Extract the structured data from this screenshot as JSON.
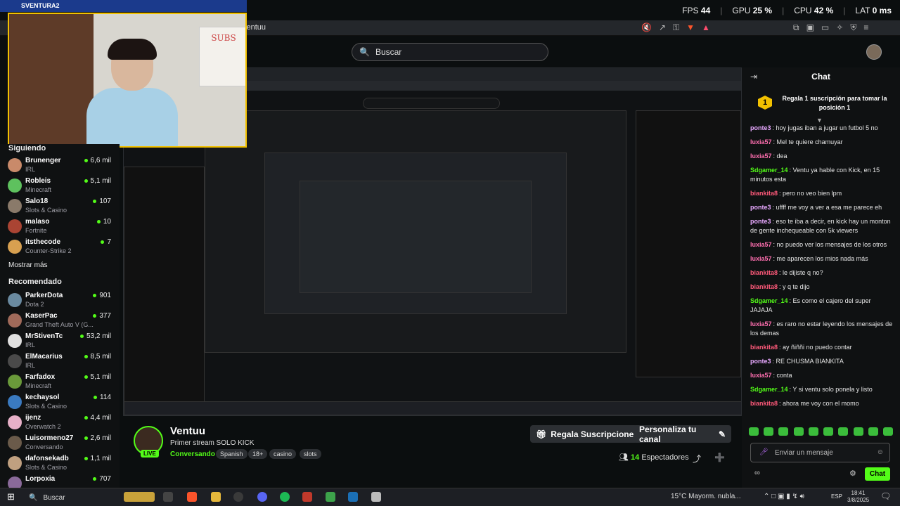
{
  "overlay": {
    "fps_label": "FPS",
    "fps": "44",
    "gpu_label": "GPU",
    "gpu": "25 %",
    "cpu_label": "CPU",
    "cpu": "42 %",
    "lat_label": "LAT",
    "lat": "0 ms"
  },
  "webcam": {
    "window_title": "SVENTURA2",
    "poster_text": "SUBS"
  },
  "browser": {
    "url": "ventuu"
  },
  "search": {
    "placeholder": "Buscar"
  },
  "sidebar": {
    "following_label": "Siguiendo",
    "following": [
      {
        "name": "Brunenger",
        "game": "IRL",
        "viewers": "6,6 mil",
        "color": "#c98a6a"
      },
      {
        "name": "Robleis",
        "game": "Minecraft",
        "viewers": "5,1 mil",
        "color": "#5ec15e"
      },
      {
        "name": "Salo18",
        "game": "Slots & Casino",
        "viewers": "107",
        "color": "#8a7a6a"
      },
      {
        "name": "malaso",
        "game": "Fortnite",
        "viewers": "10",
        "color": "#aa4433"
      },
      {
        "name": "itsthecode",
        "game": "Counter-Strike 2",
        "viewers": "7",
        "color": "#d8a050"
      }
    ],
    "show_more": "Mostrar más",
    "recommended_label": "Recomendado",
    "recommended": [
      {
        "name": "ParkerDota",
        "game": "Dota 2",
        "viewers": "901",
        "color": "#6a8aa0"
      },
      {
        "name": "KaserPac",
        "game": "Grand Theft Auto V (G...",
        "viewers": "377",
        "color": "#a06a5a"
      },
      {
        "name": "MrStivenTc",
        "game": "IRL",
        "viewers": "53,2 mil",
        "color": "#e0e0e0"
      },
      {
        "name": "ElMacarius",
        "game": "IRL",
        "viewers": "8,5 mil",
        "color": "#4a4a4a"
      },
      {
        "name": "Farfadox",
        "game": "Minecraft",
        "viewers": "5,1 mil",
        "color": "#6a9a3a"
      },
      {
        "name": "kechaysol",
        "game": "Slots & Casino",
        "viewers": "114",
        "color": "#3a7ac0"
      },
      {
        "name": "ijenz",
        "game": "Overwatch 2",
        "viewers": "4,4 mil",
        "color": "#e7b0c8"
      },
      {
        "name": "Luisormeno27",
        "game": "Conversando",
        "viewers": "2,6 mil",
        "color": "#6a5a4a"
      },
      {
        "name": "dafonsekadb",
        "game": "Slots & Casino",
        "viewers": "1,1 mil",
        "color": "#c0a080"
      },
      {
        "name": "Lorpoxia",
        "game": "",
        "viewers": "707",
        "color": "#8a6a9a"
      }
    ]
  },
  "stream": {
    "name": "Ventuu",
    "title": "Primer stream SOLO KICK",
    "category": "Conversando",
    "tags": [
      "Spanish",
      "18+",
      "casino",
      "slots"
    ],
    "live": "LIVE",
    "gift_button": "Regala Suscripciones",
    "customize_button": "Personaliza tu canal",
    "viewers_count": "14",
    "viewers_label": "Espectadores"
  },
  "chat": {
    "title": "Chat",
    "promo_rank": "1",
    "promo_text": "Regala 1 suscripción para tomar la posición 1",
    "messages": [
      {
        "user": "ponte3",
        "color": "#e7a8ff",
        "text": "hoy jugas iban a jugar un futbol 5 no"
      },
      {
        "user": "luxia57",
        "color": "#ff6fb0",
        "text": "Mel te quiere chamuyar"
      },
      {
        "user": "luxia57",
        "color": "#ff6fb0",
        "text": "dea"
      },
      {
        "user": "Sdgamer_14",
        "color": "#53fc18",
        "text": "Ventu ya hable con Kick, en 15 minutos esta"
      },
      {
        "user": "biankita8",
        "color": "#ff5a7a",
        "text": "pero no veo bien lpm"
      },
      {
        "user": "ponte3",
        "color": "#e7a8ff",
        "text": "uffff me voy a ver a esa me parece eh"
      },
      {
        "user": "ponte3",
        "color": "#e7a8ff",
        "text": "eso te iba a decir, en kick hay un monton de gente inchequeable con 5k viewers"
      },
      {
        "user": "luxia57",
        "color": "#ff6fb0",
        "text": "no puedo ver los mensajes de los otros"
      },
      {
        "user": "luxia57",
        "color": "#ff6fb0",
        "text": "me aparecen los mios nada más"
      },
      {
        "user": "biankita8",
        "color": "#ff5a7a",
        "text": "le dijiste q no?"
      },
      {
        "user": "biankita8",
        "color": "#ff5a7a",
        "text": "y q te dijo"
      },
      {
        "user": "Sdgamer_14",
        "color": "#53fc18",
        "text": "Es como el cajero del super JAJAJA"
      },
      {
        "user": "luxia57",
        "color": "#ff6fb0",
        "text": "es raro no estar leyendo los mensajes de los demas"
      },
      {
        "user": "biankita8",
        "color": "#ff5a7a",
        "text": "ay ñiññi no puedo contar"
      },
      {
        "user": "ponte3",
        "color": "#e7a8ff",
        "text": "RE CHUSMA BIANKITA"
      },
      {
        "user": "luxia57",
        "color": "#ff6fb0",
        "text": "conta"
      },
      {
        "user": "Sdgamer_14",
        "color": "#53fc18",
        "text": "Y si ventu solo ponela y listo"
      },
      {
        "user": "biankita8",
        "color": "#ff5a7a",
        "text": "ahora me voy con el momo"
      }
    ],
    "input_placeholder": "Enviar un mensaje",
    "send_button": "Chat",
    "infinity": "∞"
  },
  "taskbar": {
    "search": "Buscar",
    "weather": "15°C  Mayorm. nubla...",
    "lang": "ESP",
    "time": "18:41",
    "date": "3/8/2025"
  },
  "accent": "#53fc18"
}
